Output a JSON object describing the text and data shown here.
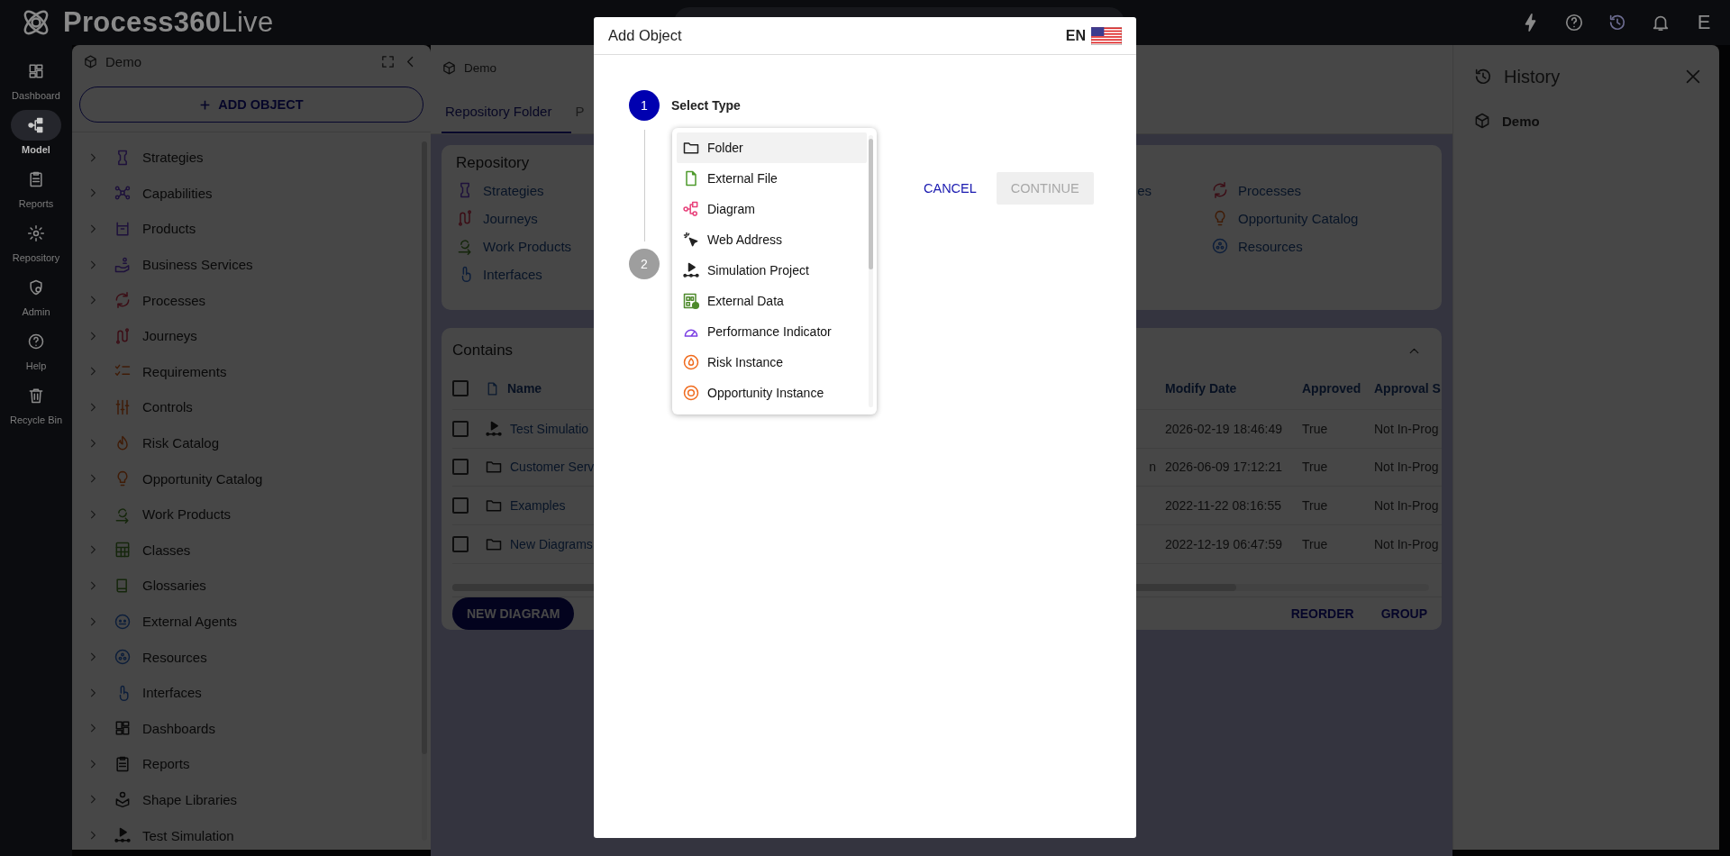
{
  "app": {
    "logo": {
      "name": "Process360",
      "suffix": "Live"
    },
    "user_initial": "E"
  },
  "rail": [
    {
      "label": "Dashboard",
      "kind": "dashboard",
      "selected": false
    },
    {
      "label": "Model",
      "kind": "model",
      "selected": true
    },
    {
      "label": "Reports",
      "kind": "reports",
      "selected": false
    },
    {
      "label": "Repository",
      "kind": "repository",
      "selected": false
    },
    {
      "label": "Admin",
      "kind": "admin",
      "selected": false
    },
    {
      "label": "Help",
      "kind": "help",
      "selected": false
    },
    {
      "label": "Recycle Bin",
      "kind": "recycle",
      "selected": false
    }
  ],
  "tree_panel": {
    "title": "Demo",
    "add_button": "ADD OBJECT",
    "items": [
      {
        "label": "Strategies",
        "kind": "strategy",
        "expanded": false
      },
      {
        "label": "Capabilities",
        "kind": "capability",
        "expanded": false
      },
      {
        "label": "Products",
        "kind": "product",
        "expanded": false
      },
      {
        "label": "Business Services",
        "kind": "service",
        "expanded": false
      },
      {
        "label": "Processes",
        "kind": "process",
        "expanded": false
      },
      {
        "label": "Journeys",
        "kind": "journey",
        "expanded": false
      },
      {
        "label": "Requirements",
        "kind": "requirement",
        "expanded": false
      },
      {
        "label": "Controls",
        "kind": "control",
        "expanded": false
      },
      {
        "label": "Risk Catalog",
        "kind": "risk",
        "expanded": false
      },
      {
        "label": "Opportunity Catalog",
        "kind": "opportunity",
        "expanded": false
      },
      {
        "label": "Work Products",
        "kind": "workproduct",
        "expanded": false
      },
      {
        "label": "Classes",
        "kind": "class",
        "expanded": false
      },
      {
        "label": "Glossaries",
        "kind": "glossary",
        "expanded": false
      },
      {
        "label": "External Agents",
        "kind": "agent",
        "expanded": false
      },
      {
        "label": "Resources",
        "kind": "resource",
        "expanded": false
      },
      {
        "label": "Interfaces",
        "kind": "interface",
        "expanded": false
      },
      {
        "label": "Dashboards",
        "kind": "dashboard",
        "expanded": false
      },
      {
        "label": "Reports",
        "kind": "reports",
        "expanded": false
      },
      {
        "label": "Shape Libraries",
        "kind": "shapelib",
        "expanded": false
      },
      {
        "label": "Test Simulation",
        "kind": "simulation",
        "expanded": false
      }
    ]
  },
  "content": {
    "title": "Demo",
    "tabs": [
      {
        "label": "Repository Folder",
        "selected": true
      },
      {
        "label": "P",
        "selected": false
      }
    ],
    "repository": {
      "title": "Repository",
      "columns": [
        [
          {
            "label": "Strategies",
            "kind": "strategy"
          },
          {
            "label": "Journeys",
            "kind": "journey"
          },
          {
            "label": "Work Products",
            "kind": "workproduct"
          },
          {
            "label": "Interfaces",
            "kind": "interface"
          }
        ],
        [
          {
            "label": "es"
          }
        ],
        [
          {
            "label": "Processes",
            "kind": "process"
          },
          {
            "label": "Opportunity Catalog",
            "kind": "opportunity"
          },
          {
            "label": "Resources",
            "kind": "resource"
          }
        ]
      ]
    },
    "contains": {
      "title": "Contains",
      "all_checked": false,
      "columns": [
        "Name",
        "Modify Date",
        "Approved",
        "Approval S"
      ],
      "rows": [
        {
          "kind": "simulation",
          "name": "Test Simulatio",
          "modify_date": "2026-02-19 18:46:49",
          "approved": "True",
          "column_6": "Not In-Prog",
          "checked": false
        },
        {
          "kind": "folder",
          "name": "Customer Serv",
          "column_3": "n",
          "modify_date": "2026-06-09 17:12:21",
          "approved": "True",
          "column_6": "Not In-Prog",
          "checked": false
        },
        {
          "kind": "folder",
          "name": "Examples",
          "modify_date": "2022-11-22 08:16:55",
          "approved": "True",
          "column_6": "Not In-Prog",
          "checked": false
        },
        {
          "kind": "folder",
          "name": "New Diagrams",
          "modify_date": "2022-12-19 06:47:59",
          "approved": "True",
          "column_6": "Not In-Prog",
          "checked": false
        }
      ],
      "new_button": "NEW DIAGRAM",
      "actions": [
        "REORDER",
        "GROUP"
      ]
    }
  },
  "history": {
    "title": "History",
    "items": [
      {
        "label": "Demo"
      }
    ]
  },
  "modal": {
    "title": "Add Object",
    "language": "EN",
    "steps": [
      {
        "number": "1",
        "label": "Select Type",
        "active": true
      },
      {
        "number": "2",
        "active": false
      }
    ],
    "types": [
      {
        "label": "Folder",
        "kind": "folder",
        "selected": true
      },
      {
        "label": "External File",
        "kind": "file",
        "selected": false
      },
      {
        "label": "Diagram",
        "kind": "diagram",
        "selected": false
      },
      {
        "label": "Web Address",
        "kind": "web",
        "selected": false
      },
      {
        "label": "Simulation Project",
        "kind": "simulation",
        "selected": false
      },
      {
        "label": "External Data",
        "kind": "data",
        "selected": false
      },
      {
        "label": "Performance Indicator",
        "kind": "kpi",
        "selected": false
      },
      {
        "label": "Risk Instance",
        "kind": "riskinst",
        "selected": false
      },
      {
        "label": "Opportunity Instance",
        "kind": "oppinst",
        "selected": false
      }
    ],
    "cancel": "CANCEL",
    "continue": {
      "label": "CONTINUE",
      "disabled": true
    }
  }
}
